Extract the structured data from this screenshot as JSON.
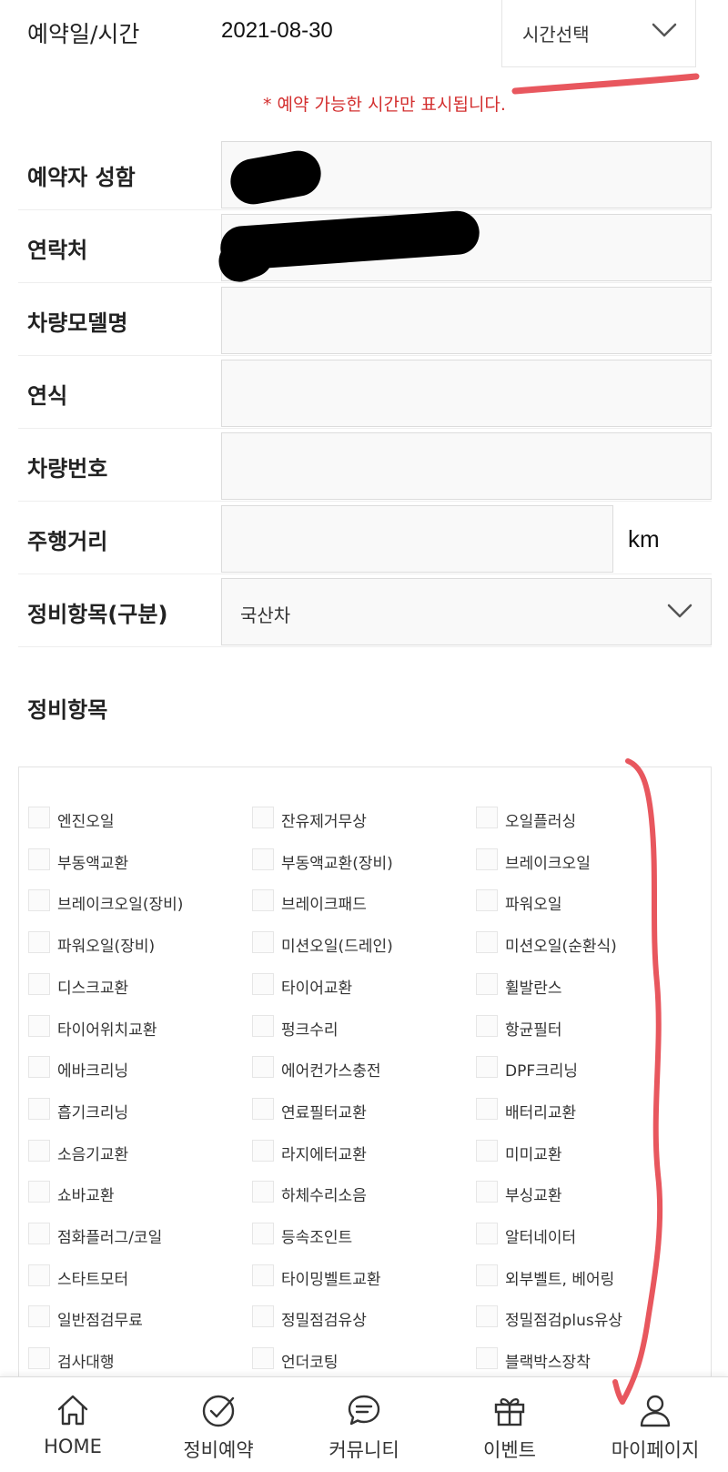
{
  "reservation": {
    "date_label": "예약일/시간",
    "date_value": "2021-08-30",
    "time_select_label": "시간선택",
    "notice": "* 예약 가능한 시간만 표시됩니다."
  },
  "form": {
    "name_label": "예약자 성함",
    "contact_label": "연락처",
    "model_label": "차량모델명",
    "year_label": "연식",
    "plate_label": "차량번호",
    "mileage_label": "주행거리",
    "mileage_unit": "km",
    "category_label": "정비항목(구분)",
    "category_value": "국산차"
  },
  "items_title": "정비항목",
  "items": [
    "엔진오일",
    "잔유제거무상",
    "오일플러싱",
    "부동액교환",
    "부동액교환(장비)",
    "브레이크오일",
    "브레이크오일(장비)",
    "브레이크패드",
    "파워오일",
    "파워오일(장비)",
    "미션오일(드레인)",
    "미션오일(순환식)",
    "디스크교환",
    "타이어교환",
    "휠발란스",
    "타이어위치교환",
    "펑크수리",
    "항균필터",
    "에바크리닝",
    "에어컨가스충전",
    "DPF크리닝",
    "흡기크리닝",
    "연료필터교환",
    "배터리교환",
    "소음기교환",
    "라지에터교환",
    "미미교환",
    "쇼바교환",
    "하체수리소음",
    "부싱교환",
    "점화플러그/코일",
    "등속조인트",
    "알터네이터",
    "스타트모터",
    "타이밍벨트교환",
    "외부벨트, 베어링",
    "일반점검무료",
    "정밀점검유상",
    "정밀점검plus유상",
    "검사대행",
    "언더코팅",
    "블랙박스장착"
  ],
  "tabbar": {
    "home": "HOME",
    "reserve": "정비예약",
    "community": "커뮤니티",
    "event": "이벤트",
    "mypage": "마이페이지"
  },
  "colors": {
    "notice_red": "#d32f2f",
    "annotation_red": "#e8575e"
  }
}
